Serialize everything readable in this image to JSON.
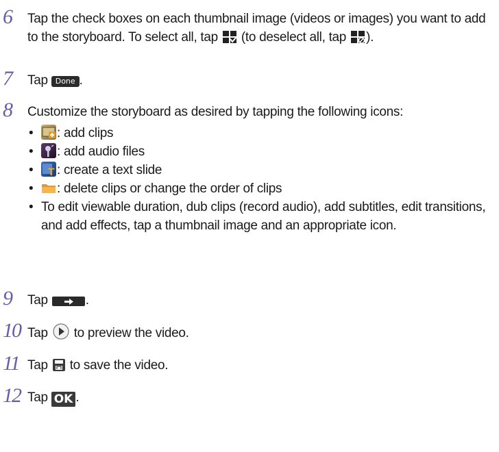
{
  "colors": {
    "step_number": "#6a5ba8"
  },
  "steps": [
    {
      "number": "6",
      "text_a": "Tap the check boxes on each thumbnail image (videos or images) you want to add to the storyboard. To select all, tap ",
      "icon_a": "select-all-icon",
      "text_b": " (to deselect all, tap ",
      "icon_b": "deselect-all-icon",
      "text_c": ")."
    },
    {
      "number": "7",
      "text_a": "Tap ",
      "button": "Done",
      "text_b": "."
    },
    {
      "number": "8",
      "text": "Customize the storyboard as desired by tapping the following icons:",
      "bullets": [
        {
          "icon": "add-clips-icon",
          "text": ": add clips"
        },
        {
          "icon": "add-audio-icon",
          "text": ": add audio files"
        },
        {
          "icon": "text-slide-icon",
          "text": ": create a text slide"
        },
        {
          "icon": "folder-icon",
          "text": ": delete clips or change the order of clips"
        },
        {
          "text": "To edit viewable duration, dub clips (record audio), add subtitles, edit transitions, and add effects, tap a thumbnail image and an appropriate icon."
        }
      ]
    },
    {
      "number": "9",
      "text_a": "Tap ",
      "icon": "next-arrow-button-icon",
      "text_b": "."
    },
    {
      "number": "10",
      "text_a": "Tap ",
      "icon": "play-icon",
      "text_b": " to preview the video."
    },
    {
      "number": "11",
      "text_a": "Tap ",
      "icon": "save-icon",
      "text_b": " to save the video."
    },
    {
      "number": "12",
      "text_a": "Tap ",
      "button": "OK",
      "text_b": "."
    }
  ]
}
